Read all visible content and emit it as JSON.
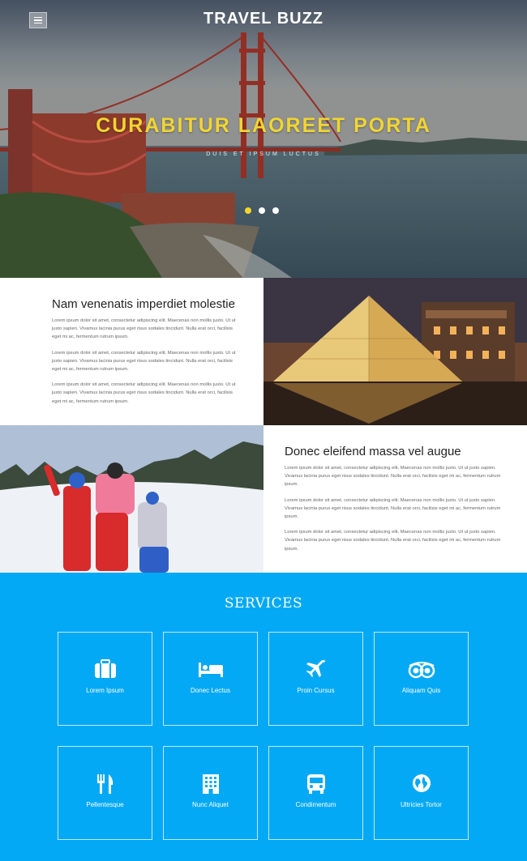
{
  "header": {
    "brand": "TRAVEL BUZZ",
    "menu_icon": "hamburger-icon"
  },
  "hero": {
    "title": "CURABITUR LAOREET PORTA",
    "subtitle": "DUIS ET IPSUM LUCTUS",
    "slides": 3,
    "active_slide": 1
  },
  "features": [
    {
      "heading": "Nam venenatis imperdiet molestie",
      "paragraphs": [
        "Lorem ipsum dolor sit amet, consectetur adipiscing elit. Maecenas non mollis justo. Ut ut justo sapien. Vivamus lacinia purus eget risus sodales tincidunt. Nulla erat orci, facilisis eget mi ac, fermentum rutrum ipsum.",
        "Lorem ipsum dolor sit amet, consectetur adipiscing elit. Maecenas non mollis justo. Ut ut justo sapien. Vivamus lacinia purus eget risus sodales tincidunt. Nulla erat orci, facilisis eget mi ac, fermentum rutrum ipsum.",
        "Lorem ipsum dolor sit amet, consectetur adipiscing elit. Maecenas non mollis justo. Ut ut justo sapien. Vivamus lacinia purus eget risus sodales tincidunt. Nulla erat orci, facilisis eget mi ac, fermentum rutrum ipsum."
      ]
    },
    {
      "heading": "Donec eleifend massa vel augue",
      "paragraphs": [
        "Lorem ipsum dolor sit amet, consectetur adipiscing elit. Maecenas non mollis justo. Ut ut justo sapien. Vivamus lacinia purus eget risus sodales tincidunt. Nulla erat orci, facilisis eget mi ac, fermentum rutrum ipsum.",
        "Lorem ipsum dolor sit amet, consectetur adipiscing elit. Maecenas non mollis justo. Ut ut justo sapien. Vivamus lacinia purus eget risus sodales tincidunt. Nulla erat orci, facilisis eget mi ac, fermentum rutrum ipsum.",
        "Lorem ipsum dolor sit amet, consectetur adipiscing elit. Maecenas non mollis justo. Ut ut justo sapien. Vivamus lacinia purus eget risus sodales tincidunt. Nulla erat orci, facilisis eget mi ac, fermentum rutrum ipsum."
      ]
    }
  ],
  "services": {
    "title": "SERVICES",
    "items": [
      {
        "label": "Lorem Ipsum",
        "icon": "suitcase-icon"
      },
      {
        "label": "Donec Lectus",
        "icon": "bed-icon"
      },
      {
        "label": "Proin Cursus",
        "icon": "plane-icon"
      },
      {
        "label": "Aliquam Quis",
        "icon": "binoculars-icon"
      },
      {
        "label": "Pellentesque",
        "icon": "cutlery-icon"
      },
      {
        "label": "Nunc Aliquet",
        "icon": "building-icon"
      },
      {
        "label": "Condimentum",
        "icon": "bus-icon"
      },
      {
        "label": "Ultricies Tortor",
        "icon": "globe-icon"
      }
    ]
  },
  "colors": {
    "accent_yellow": "#f2d531",
    "services_bg": "#03a9f4"
  }
}
